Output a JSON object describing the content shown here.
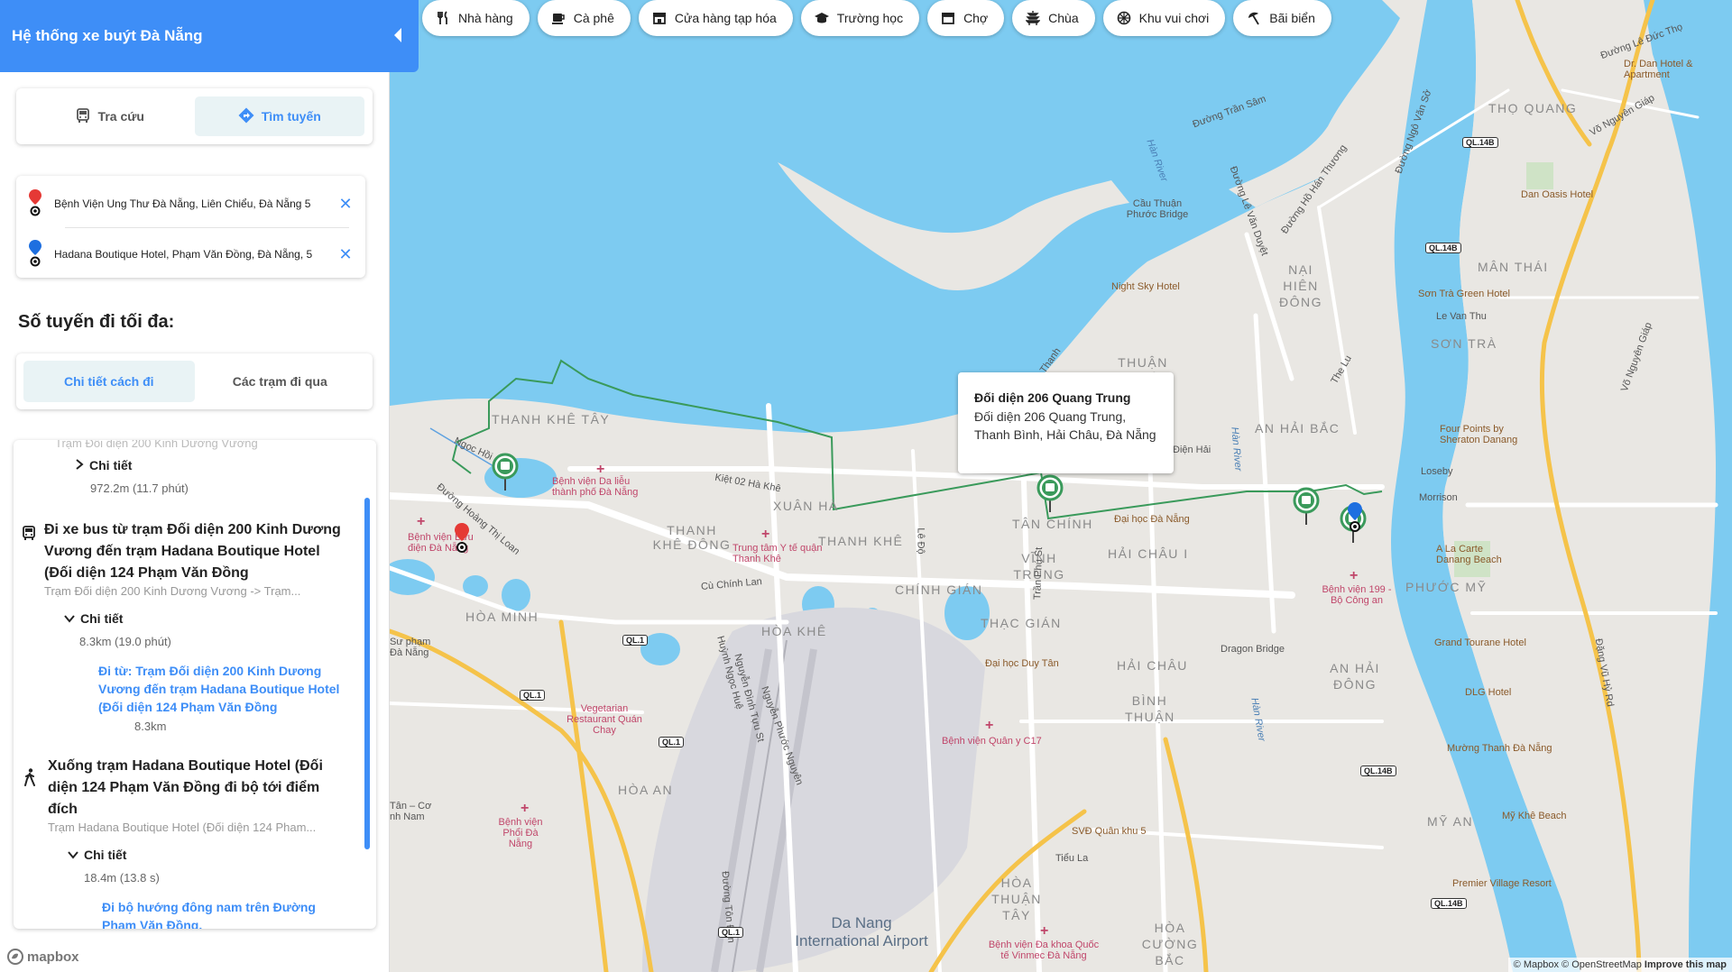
{
  "header": {
    "title": "Hệ thống xe buýt Đà Nẵng"
  },
  "modes": [
    {
      "label": "Tra cứu",
      "icon": "bus-icon",
      "active": false
    },
    {
      "label": "Tìm tuyến",
      "icon": "directions-icon",
      "active": true
    }
  ],
  "route": {
    "origin": "Bệnh Viện Ung Thư Đà Nẵng, Liên Chiểu, Đà Nẵng 5",
    "destination": "Hadana Boutique Hotel, Phạm Văn Đồng, Đà Nẵng, 5"
  },
  "max_routes_label": "Số tuyến đi tối đa:",
  "tabs": [
    {
      "label": "Chi tiết cách đi",
      "active": true
    },
    {
      "label": "Các trạm đi qua",
      "active": false
    }
  ],
  "steps": {
    "prev_sub": "Trạm Đối diện 200 Kinh Dương Vương",
    "prev_detail": "Chi tiết",
    "prev_meta": "972.2m (11.7 phút)",
    "bus_title": "Đi xe bus từ trạm Đối diện 200 Kinh Dương Vương đến trạm Hadana Boutique Hotel (Đối diện 124 Phạm Văn Đồng",
    "bus_sub": "Trạm Đối diện 200 Kinh Dương Vương -> Trạm...",
    "bus_detail": "Chi tiết",
    "bus_meta": "8.3km (19.0 phút)",
    "bus_link": "Đi từ: Trạm Đối diện 200 Kinh Dương Vương đến trạm Hadana Boutique Hotel (Đối diện 124 Phạm Văn Đồng",
    "bus_link_dist": "8.3km",
    "walk_title": "Xuống trạm Hadana Boutique Hotel (Đối diện 124 Phạm Văn Đồng đi bộ tới điểm đích",
    "walk_sub": "Trạm Hadana Boutique Hotel (Đối diện 124 Pham...",
    "walk_detail": "Chi tiết",
    "walk_meta": "18.4m (13.8 s)",
    "walk_link": "Đi bộ hướng đông nam trên Đường Phạm Văn Đồng."
  },
  "chips": [
    {
      "label": "Nhà hàng",
      "icon": "restaurant-icon"
    },
    {
      "label": "Cà phê",
      "icon": "coffee-icon"
    },
    {
      "label": "Cửa hàng tạp hóa",
      "icon": "store-icon"
    },
    {
      "label": "Trường học",
      "icon": "school-icon"
    },
    {
      "label": "Chợ",
      "icon": "market-icon"
    },
    {
      "label": "Chùa",
      "icon": "pagoda-icon"
    },
    {
      "label": "Khu vui chơi",
      "icon": "amusement-icon"
    },
    {
      "label": "Bãi biển",
      "icon": "beach-icon"
    }
  ],
  "popup": {
    "title": "Đối diện 206 Quang Trung",
    "line1": "Đối diện 206 Quang Trung,",
    "line2": "Thanh Bình, Hải Châu, Đà Nẵng"
  },
  "map_labels": {
    "thanh_khe_tay": "THANH KHÊ TÂY",
    "thanh_khe_dong": "THANH KHÊ ĐÔNG",
    "thanh_khe": "THANH KHÊ",
    "xuan_ha": "XUÂN HÀ",
    "tan_chinh": "TÂN CHÍNH",
    "hai_chau_i": "HẢI CHÂU I",
    "vinh_trung": "VĨNH TRUNG",
    "chinh_gian": "CHÍNH GIÁN",
    "thac_gian": "THẠC GIÁN",
    "hoa_minh": "HÒA MINH",
    "hoa_khe": "HÒA KHÊ",
    "hoa_an": "HÒA AN",
    "hai_chau": "HẢI CHÂU",
    "binh_thuan": "BÌNH THUẬN",
    "hoa_thuan_tay": "HÒA THUẬN TÂY",
    "hoa_cuong_bac": "HÒA CƯỜNG BẮC",
    "tho_quang": "THỌ QUANG",
    "nai_hien_dong": "NẠI HIÊN ĐÔNG",
    "man_thai": "MÂN THÁI",
    "son_tra": "SƠN TRÀ",
    "an_hai_bac": "AN HẢI BẮC",
    "phuoc_my": "PHƯỚC MỸ",
    "an_hai_dong": "AN HẢI ĐÔNG",
    "my_an": "MỸ AN",
    "thuan_phuoc": "THUẬN PHƯỚC",
    "airport": "Da Nang International Airport",
    "benh_vien_da_lieu": "Bệnh viện Da liễu thành phố Đà Nẵng",
    "trung_tam_y_te": "Trung tâm Y tế quận Thanh Khê",
    "benh_vien_buu_dien": "Bệnh viện Bưu điện Đà Nẵng",
    "vegetarian": "Vegetarian Restaurant Quán Chay",
    "dai_hoc_duy_tan": "Đại học Duy Tân",
    "dai_hoc_da_nang": "Đại học Đà Nẵng",
    "benh_vien_quan_y": "Bệnh viện Quân y C17",
    "benh_vien_phoi": "Bệnh viện Phổi Đà Nẵng",
    "svd_quan_khu_5": "SVĐ Quân khu 5",
    "benh_vien_da_khoa": "Bệnh viện Đa khoa Quốc tế Vinmec Đà Nẵng",
    "benh_vien_199": "Bệnh viện 199 - Bộ Công an",
    "dragon_bridge": "Dragon Bridge",
    "cau_thuan_phuoc": "Cầu Thuận Phước Bridge",
    "night_sky": "Night Sky Hotel",
    "son_tra_green": "Sơn Trà Green Hotel",
    "four_points": "Four Points by Sheraton Danang",
    "la_carte": "A La Carte Danang Beach",
    "grand_tourane": "Grand Tourane Hotel",
    "dlg": "DLG Hotel",
    "muong_thanh": "Mường Thanh Đà Nẵng",
    "my_khe": "Mỹ Khê Beach",
    "premier": "Premier Village Resort",
    "dr_dan": "Dr. Dan Hotel & Apartment",
    "dan_oasis": "Dan Oasis Hotel",
    "loseby": "Loseby",
    "morrison": "Morrison",
    "le_van_thu": "Le Van Thu",
    "su_pham": "Sư phạm Đà Nẵng",
    "tan_co": "Tân – Cơ nh Nam",
    "dien_hai": "Điện Hải",
    "han_river": "Hàn River",
    "han_river2": "Hàn River",
    "han_river3": "Hàn River",
    "kiet_02": "Kiệt 02 Hà Khê",
    "ngoc_hoi": "Ngọc Hồi",
    "hoang_thi_loan": "Đường Hoàng Thị Loan",
    "cu_chinh_lan": "Cù Chính Lan",
    "le_do": "Lê Độ",
    "tran_phu": "Trần Phú St",
    "huynh_ngoc_hue": "Huỳnh Ngọc Huệ",
    "nguyen_dinh_tuu": "Nguyễn Đình Tựu St",
    "nguyen_phuoc": "Nguyễn Phước Nguyên",
    "ton_dan": "Đường Tôn Đản",
    "tieu_la": "Tiểu La",
    "tran_sam": "Đường Trần Sâm",
    "le_van_duyet": "Đường Lê Văn Duyệt",
    "ho_han_thuong": "Đường Hồ Hán Thương",
    "le_duc_tho": "Đường Lê Đức Thọ",
    "vo_nguyen_giap": "Võ Nguyên Giáp",
    "dang_vu_hy": "Đặng Vũ Hỷ Rd",
    "the_lu": "The Lu",
    "ngo_van_don": "Đường Ngô Văn Sở",
    "ql14b_1": "QL.14B",
    "ql14b_2": "QL.14B",
    "ql14b_3": "QL.14B",
    "ql14b_4": "QL.14B",
    "ql1_1": "QL.1",
    "ql1_2": "QL.1",
    "ql1_3": "QL.1",
    "ql1_4": "QL.1",
    "thanh_street": "Thanh"
  },
  "attribution": {
    "mapbox": "© Mapbox",
    "osm": "© OpenStreetMap",
    "improve": "Improve this map"
  },
  "mapbox_logo": "mapbox",
  "colors": {
    "accent": "#3e8ef7",
    "route": "#3a9a5b",
    "water": "#7ccaf0",
    "land": "#e9e7e3"
  }
}
